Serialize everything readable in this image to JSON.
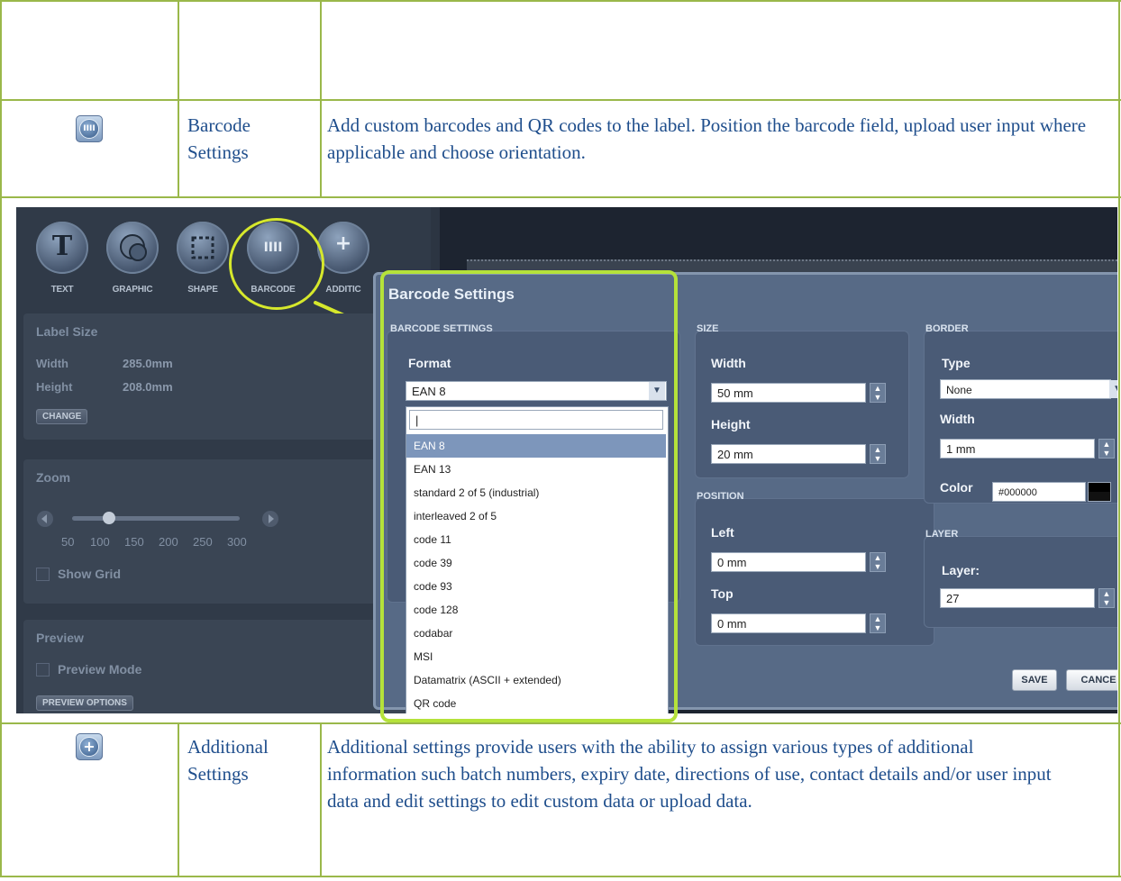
{
  "rows": {
    "barcode": {
      "icon": "barcode-icon",
      "icon_glyph": "IIII",
      "name": "Barcode Settings",
      "description": "Add custom barcodes and QR codes to the label.  Position the barcode field, upload user input where applicable and choose orientation."
    },
    "additional": {
      "icon": "plus-icon",
      "icon_glyph": "+",
      "name": "Additional Settings",
      "description": "Additional settings provide users with the ability to assign various types of additional information such batch numbers, expiry date, directions of use, contact details and/or user input data and edit settings to edit custom data or upload data."
    }
  },
  "screenshot": {
    "toolbar": {
      "tools": [
        {
          "name": "text-tool",
          "glyph": "T",
          "label": "TEXT"
        },
        {
          "name": "graphic-tool",
          "glyph": "",
          "label": "GRAPHIC"
        },
        {
          "name": "shape-tool",
          "glyph": "",
          "label": "SHAPE"
        },
        {
          "name": "barcode-tool",
          "glyph": "IIII",
          "label": "BARCODE"
        },
        {
          "name": "additional-tool",
          "glyph": "+",
          "label": "ADDITIC"
        }
      ]
    },
    "label_size": {
      "title": "Label Size",
      "width_label": "Width",
      "width_value": "285.0mm",
      "height_label": "Height",
      "height_value": "208.0mm",
      "change_button": "CHANGE"
    },
    "zoom": {
      "title": "Zoom",
      "ticks": [
        "50",
        "100",
        "150",
        "200",
        "250",
        "300"
      ],
      "value": 100,
      "show_grid": "Show Grid"
    },
    "preview": {
      "title": "Preview",
      "preview_mode": "Preview Mode",
      "options_button": "PREVIEW OPTIONS"
    },
    "dialog": {
      "title": "Barcode Settings",
      "barcode_group": {
        "title": "BARCODE SETTINGS",
        "format_label": "Format",
        "format_value": "EAN 8",
        "search_value": "|",
        "options": [
          "EAN 8",
          "EAN 13",
          "standard 2 of 5 (industrial)",
          "interleaved 2 of 5",
          "code 11",
          "code 39",
          "code 93",
          "code 128",
          "codabar",
          "MSI",
          "Datamatrix (ASCII + extended)",
          "QR code"
        ],
        "selected_option": "EAN 8"
      },
      "size_group": {
        "title": "SIZE",
        "width_label": "Width",
        "width_value": "50 mm",
        "height_label": "Height",
        "height_value": "20 mm"
      },
      "position_group": {
        "title": "POSITION",
        "left_label": "Left",
        "left_value": "0 mm",
        "top_label": "Top",
        "top_value": "0 mm"
      },
      "border_group": {
        "title": "BORDER",
        "type_label": "Type",
        "type_value": "None",
        "width_label": "Width",
        "width_value": "1 mm",
        "color_label": "Color",
        "color_value": "#000000"
      },
      "layer_group": {
        "title": "LAYER",
        "layer_label": "Layer:",
        "layer_value": "27"
      },
      "save_button": "SAVE",
      "cancel_button": "CANCE"
    }
  },
  "colors": {
    "table_border": "#9ab84a",
    "text": "#1f4e8c",
    "highlight": "#d6e82c",
    "dropdown_outline": "#b5e23a"
  }
}
